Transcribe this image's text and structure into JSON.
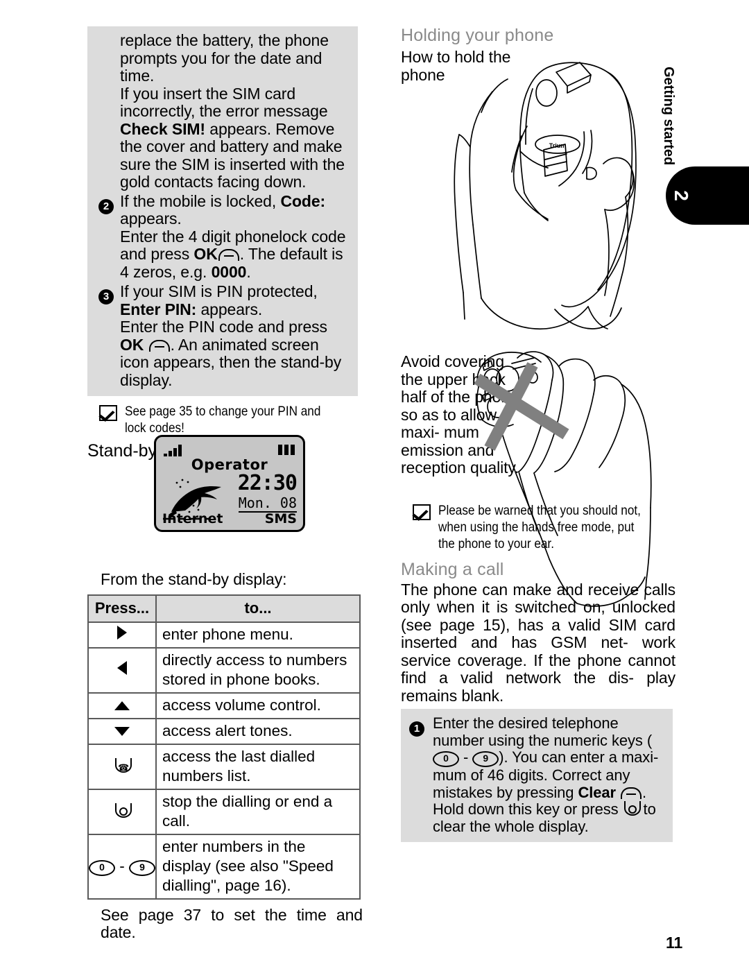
{
  "page": {
    "number": "11",
    "chapter_tab_number": "2",
    "chapter_label": "Getting started"
  },
  "left_column": {
    "gray_box": {
      "intro_paragraph": "replace the battery, the phone prompts you for the date and time.",
      "sim_paragraph_pre": "If you insert the SIM card incorrectly, the error message ",
      "sim_paragraph_bold": "Check SIM!",
      "sim_paragraph_post": " appears. Remove the cover and battery and make sure the SIM is inserted with the gold contacts facing down.",
      "steps": [
        {
          "num": "2",
          "line1_pre": "If the mobile is locked, ",
          "line1_bold": "Code:",
          "line1_post": " appears.",
          "line2_pre": "Enter the 4 digit phonelock code and press ",
          "line2_bold": "OK",
          "line2_key": "ok-key-icon",
          "line2_mid": ". The default is 4 zeros, e.g. ",
          "line2_bold2": "0000",
          "line2_post": "."
        },
        {
          "num": "3",
          "line1_pre": "If your SIM is PIN protected, ",
          "line1_bold": "Enter PIN:",
          "line1_post": " appears.",
          "line2_pre": "Enter the PIN code and press ",
          "line2_bold": "OK",
          "line2_key": "ok-key-icon",
          "line2_post": ". An animated screen icon appears, then the stand-by display."
        }
      ]
    },
    "note": "See page 35 to change your PIN and lock codes!",
    "standby_heading": "Stand-by display",
    "phone_screen": {
      "signal_icon": "signal-bars-icon",
      "battery_icon": "battery-icon",
      "operator": "Operator",
      "time": "22:30",
      "date": "Mon. 08",
      "soft_left": "Internet",
      "soft_right": "SMS",
      "wallpaper_icon": "dolphin-icon"
    },
    "from_standby_label": "From the stand-by display:",
    "key_table": {
      "headers": [
        "Press...",
        "to..."
      ],
      "rows": [
        {
          "key_icon": "arrow-right-icon",
          "key_text": "",
          "action": "enter phone menu."
        },
        {
          "key_icon": "arrow-left-icon",
          "key_text": "",
          "action": "directly access to numbers stored in phone books."
        },
        {
          "key_icon": "arrow-up-icon",
          "key_text": "",
          "action": "access volume control."
        },
        {
          "key_icon": "arrow-down-icon",
          "key_text": "",
          "action": "access alert tones."
        },
        {
          "key_icon": "send-key-icon",
          "key_text": "",
          "action": "access the last dialled numbers list."
        },
        {
          "key_icon": "end-key-icon",
          "key_text": "",
          "action": "stop the dialling or end a call."
        },
        {
          "key_icon": "numeric-keys-icon",
          "key_text": "0 - 9",
          "action": "enter numbers in the display (see also \"Speed dialling\", page 16)."
        }
      ]
    },
    "see_page_37": "See page 37 to set the time and date."
  },
  "right_column": {
    "holding_heading": "Holding your phone",
    "how_to_hold": "How to hold the phone",
    "hand_phone_illustration": "hand-holding-phone-correct-illustration",
    "avoid_text": "Avoid covering the upper back half of the phone so as to allow maxi- mum emission and reception quality.",
    "hand_phone_wrong_illustration": "hand-covering-phone-wrong-illustration",
    "warning_note": "Please be warned that you should not, when using the hands free mode, put the phone to your ear.",
    "making_a_call_heading": "Making a call",
    "making_a_call_body": "The phone can make and receive calls only when it is switched on, unlocked (see page 15), has a valid SIM card inserted and has GSM net- work service coverage. If the phone cannot find a valid network the dis- play remains blank.",
    "gray_box_step": {
      "num": "1",
      "part1": "Enter the desired telephone number using the numeric keys (",
      "key_zero": "0",
      "dash": " - ",
      "key_nine": "9",
      "part2": "). You can enter a maxi- mum of 46 digits. Correct any mistakes by pressing ",
      "bold_clear": "Clear",
      "clear_key": "ok-key-icon",
      "part3": ". Hold down this key or press ",
      "end_key": "end-key-icon",
      "part4": " to clear the whole display."
    }
  },
  "colors": {
    "gray_box": "#dcdcdc",
    "heading_gray": "#8a8a8a",
    "screen_bg": "#c6c6c6",
    "table_border": "#5a5a5a",
    "cross_mark": "#808080"
  }
}
